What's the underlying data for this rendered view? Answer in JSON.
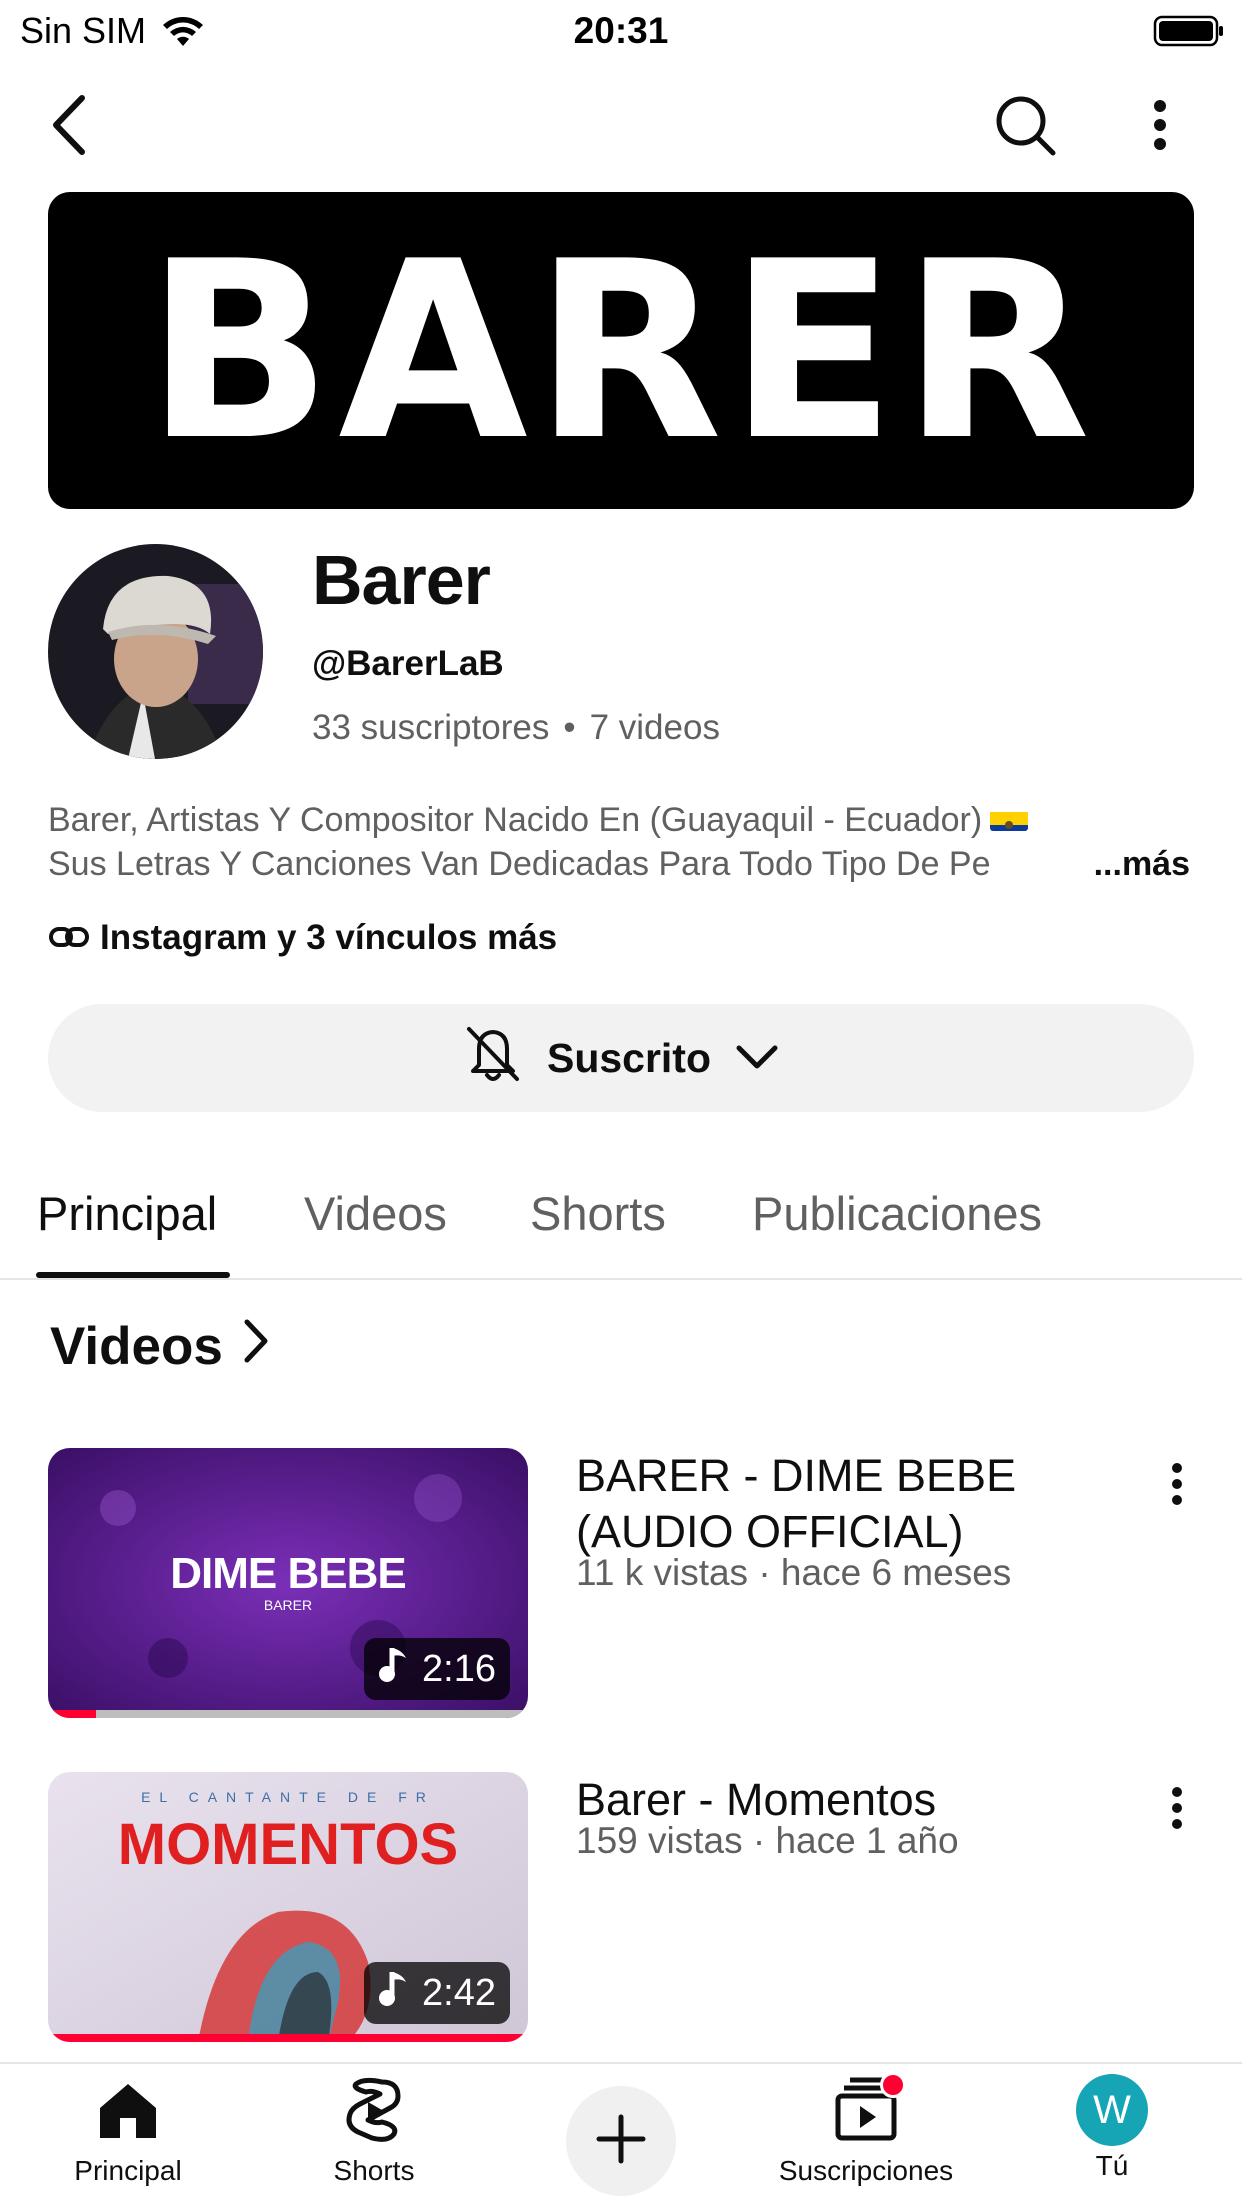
{
  "status_bar": {
    "carrier": "Sin SIM",
    "time": "20:31"
  },
  "top_nav": {
    "back_icon": "back-arrow-icon",
    "search_icon": "search-icon",
    "menu_icon": "more-vert-icon"
  },
  "banner": {
    "text": "BARER"
  },
  "channel": {
    "name": "Barer",
    "handle": "@BarerLaB",
    "subscribers": "33 suscriptores",
    "videos_count": "7 videos",
    "description_line1": "Barer, Artistas Y Compositor Nacido En (Guayaquil - Ecuador)",
    "description_line2": "Sus Letras Y Canciones Van Dedicadas Para Todo Tipo De Pe",
    "more_label": "...más",
    "links_label": "Instagram y 3 vínculos más"
  },
  "subscribe": {
    "label": "Suscrito"
  },
  "tabs": [
    {
      "label": "Principal",
      "active": true
    },
    {
      "label": "Videos",
      "active": false
    },
    {
      "label": "Shorts",
      "active": false
    },
    {
      "label": "Publicaciones",
      "active": false
    }
  ],
  "section": {
    "title": "Videos"
  },
  "videos": [
    {
      "title": "BARER - DIME BEBE (AUDIO OFFICIAL)",
      "meta": "11 k vistas · hace 6 meses",
      "duration": "2:16",
      "thumb_text": "DIME BEBE",
      "thumb_subtext": "BARER",
      "watched_fraction": 0.1
    },
    {
      "title": "Barer - Momentos",
      "meta": "159 vistas · hace 1 año",
      "duration": "2:42",
      "thumb_text": "MOMENTOS",
      "thumb_subtext": "EL CANTANTE DE FR",
      "watched_fraction": 1.0
    }
  ],
  "bottom_nav": [
    {
      "label": "Principal",
      "icon": "home-icon"
    },
    {
      "label": "Shorts",
      "icon": "shorts-icon"
    },
    {
      "label": "",
      "icon": "create-plus-icon"
    },
    {
      "label": "Suscripciones",
      "icon": "subscriptions-icon"
    },
    {
      "label": "Tú",
      "icon": "profile-avatar",
      "avatar_letter": "W"
    }
  ],
  "colors": {
    "accent": "#ff0033",
    "text": "#0f0f0f",
    "muted": "#606060",
    "avatar_bg": "#15a5b5"
  }
}
